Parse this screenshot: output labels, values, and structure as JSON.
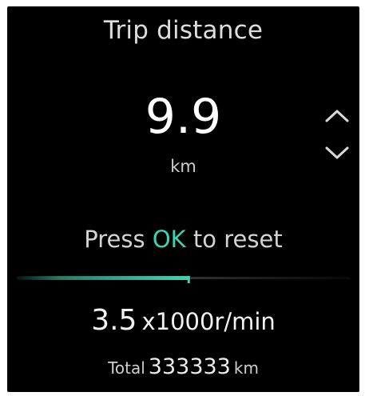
{
  "trip": {
    "title": "Trip distance",
    "value": "9.9",
    "unit": "km"
  },
  "reset": {
    "prefix": "Press ",
    "key": "OK",
    "suffix": " to reset"
  },
  "rpm": {
    "value": "3.5",
    "unit": "x1000r/min",
    "fraction": 0.52
  },
  "total": {
    "label": "Total",
    "value": "333333",
    "unit": "km"
  },
  "icons": {
    "up": "chevron-up-icon",
    "down": "chevron-down-icon"
  },
  "colors": {
    "accent": "#3ed3b2",
    "background": "#000000",
    "text": "#e6e6e6"
  }
}
